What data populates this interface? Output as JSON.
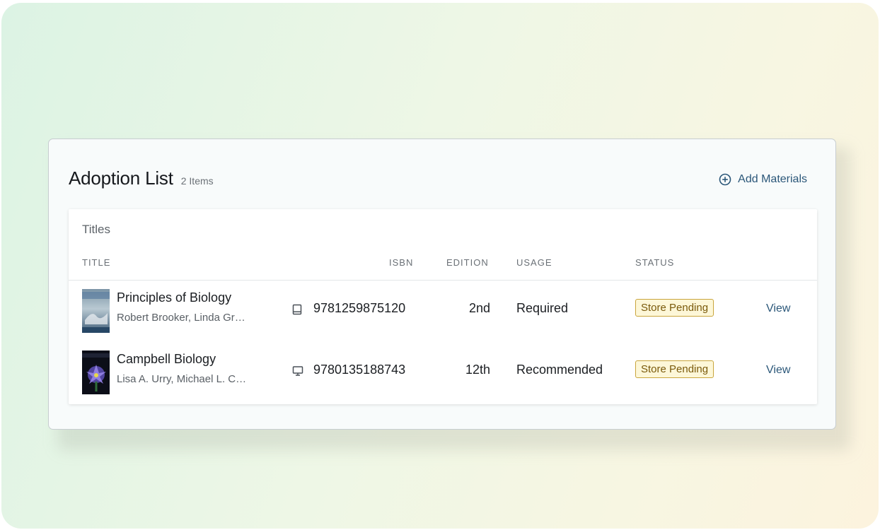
{
  "header": {
    "title": "Adoption List",
    "count": "2 Items",
    "add_label": "Add Materials"
  },
  "panel": {
    "label": "Titles",
    "columns": {
      "title": "TITLE",
      "isbn": "ISBN",
      "edition": "EDITION",
      "usage": "USAGE",
      "status": "STATUS"
    }
  },
  "rows": [
    {
      "title": "Principles of Biology",
      "authors": "Robert Brooker, Linda Gr…",
      "format_icon": "book-icon",
      "isbn": "9781259875120",
      "edition": "2nd",
      "usage": "Required",
      "status": "Store Pending",
      "action": "View"
    },
    {
      "title": "Campbell Biology",
      "authors": "Lisa A. Urry, Michael L. C…",
      "format_icon": "monitor-icon",
      "isbn": "9780135188743",
      "edition": "12th",
      "usage": "Recommended",
      "status": "Store Pending",
      "action": "View"
    }
  ],
  "colors": {
    "accent": "#2b5779",
    "badge_border": "#c9a53c",
    "badge_bg": "#fdf7d8",
    "badge_text": "#7a5a0b"
  }
}
